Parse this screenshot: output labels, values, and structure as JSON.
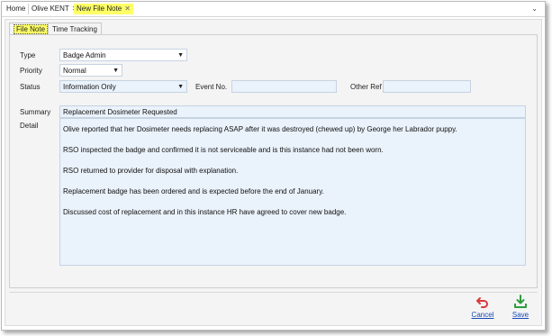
{
  "doc_tabs": [
    {
      "label": "Home"
    },
    {
      "label": "Olive KENT",
      "close": "✕"
    },
    {
      "label": "New File Note",
      "close": "✕"
    }
  ],
  "overflow_chevron": "⌄",
  "sub_tabs": [
    "File Note",
    "Time Tracking"
  ],
  "form": {
    "type_label": "Type",
    "type_value": "Badge Admin",
    "priority_label": "Priority",
    "priority_value": "Normal",
    "status_label": "Status",
    "status_value": "Information Only",
    "event_label": "Event No.",
    "event_value": "",
    "other_ref_label": "Other Ref",
    "other_ref_value": "",
    "summary_label": "Summary",
    "summary_value": "Replacement Dosimeter Requested",
    "detail_label": "Detail",
    "detail_lines": [
      "Olive reported that her Dosimeter needs replacing ASAP after it was destroyed (chewed up) by George her Labrador puppy.",
      "RSO inspected the badge and confirmed it is not serviceable and is this instance had not  been worn.",
      "RSO returned to provider for disposal with explanation.",
      "Replacement badge has been ordered and is expected before the end of January.",
      "Discussed cost of replacement and in this instance HR have agreed to cover new badge."
    ]
  },
  "actions": {
    "cancel_label": "Cancel",
    "save_label": "Save"
  },
  "colors": {
    "active_tab": "#ffff66",
    "field_bg": "#eaf2fb",
    "link": "#1a4ab8",
    "cancel_icon": "#d93a3a",
    "save_icon": "#2e9e3e"
  }
}
